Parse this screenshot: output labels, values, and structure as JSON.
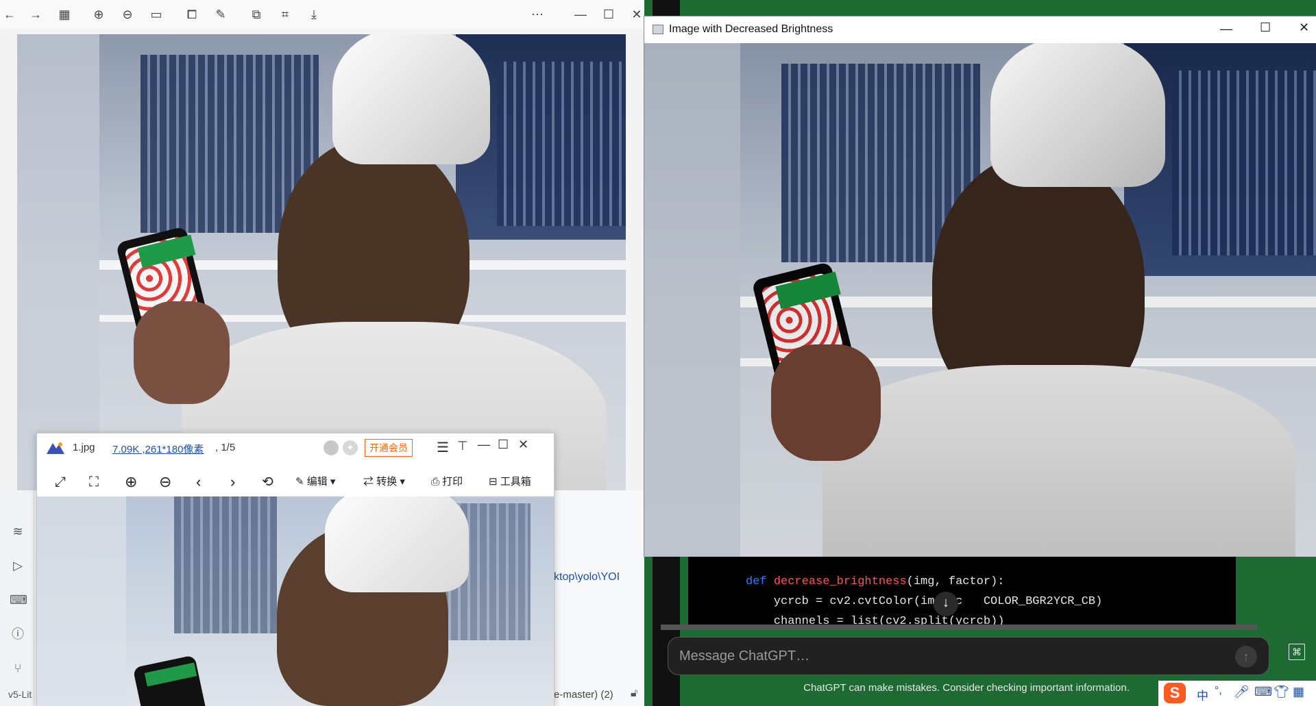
{
  "viewer": {
    "toolbar_icons": [
      "back-arrow-icon",
      "forward-arrow-icon",
      "grid-icon",
      "zoom-in-icon",
      "zoom-out-icon",
      "actual-size-icon",
      "crop-icon",
      "edit-icon",
      "copy-icon",
      "select-icon",
      "save-icon",
      "more-icon"
    ]
  },
  "ide": {
    "path_fragment": "ktop\\yolo\\YOI",
    "left_status": "v5-Lit",
    "branch_status": "e-master) (2)"
  },
  "chat": {
    "code_lines": [
      {
        "kw": "def",
        "fn": "decrease_brightness",
        "rest": "(img, factor):"
      },
      {
        "text": "    ycrcb = cv2.cvtColor(img, c   COLOR_BGR2YCR_CB)"
      },
      {
        "text": "    channels = list(cv2.split(ycrcb))"
      }
    ],
    "input_placeholder": "Message ChatGPT…",
    "disclaimer": "ChatGPT can make mistakes. Consider checking important information."
  },
  "cv_window": {
    "title": "Image with Decreased Brightness"
  },
  "mini_viewer": {
    "filename": "1.jpg",
    "file_info": "7.09K ,261*180像素",
    "page": ", 1/5",
    "vip_label": "开通会员",
    "tools": {
      "edit": "编辑",
      "convert": "转换",
      "print": "打印",
      "toolbox": "工具箱"
    }
  },
  "taskbar": {
    "ime_label": "中",
    "ime_punct": "°,"
  },
  "colors": {
    "chat_bg": "#1d6b32",
    "code_keyword": "#2f7cf6",
    "code_function": "#ff5252",
    "vip_orange": "#ff6a00"
  }
}
